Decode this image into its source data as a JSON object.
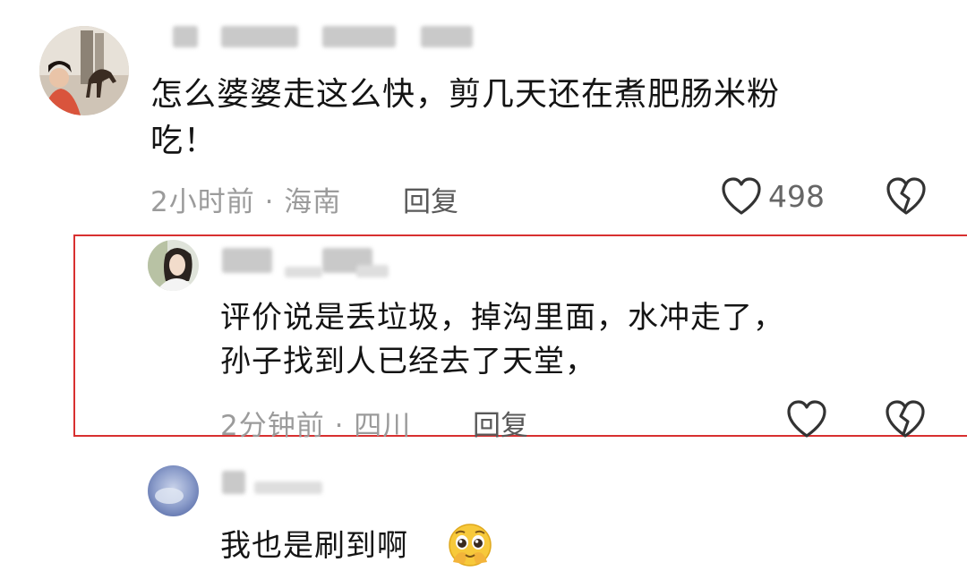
{
  "comments": [
    {
      "text_line1": "怎么婆婆走这么快，剪几天还在煮肥肠米粉",
      "text_line2": "吃！",
      "meta": "2小时前 · 海南",
      "reply_label": "回复",
      "like_count": "498",
      "like_icon": "heart-outline-icon",
      "dislike_icon": "broken-heart-icon"
    },
    {
      "text_line1": "评价说是丢垃圾，掉沟里面，水冲走了，",
      "text_line2": "孙子找到人已经去了天堂，",
      "meta": "2分钟前 · 四川",
      "reply_label": "回复",
      "like_icon": "heart-outline-icon",
      "dislike_icon": "broken-heart-icon"
    },
    {
      "text": "我也是刷到啊",
      "emoji_icon": "pleading-face-emoji"
    }
  ],
  "colors": {
    "highlight_border": "#d83030",
    "meta_text": "#9b9b9b"
  }
}
